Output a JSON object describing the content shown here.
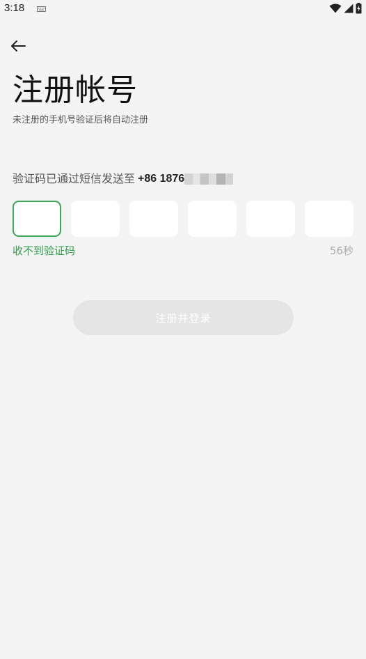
{
  "status_bar": {
    "time": "3:18"
  },
  "header": {
    "back_icon": "arrow-left-icon"
  },
  "main": {
    "title": "注册帐号",
    "subtitle": "未注册的手机号验证后将自动注册",
    "sent_prefix": "验证码已通过短信发送至",
    "phone_visible": "+86 1876",
    "code_length": 6,
    "resend_label": "收不到验证码",
    "countdown": "56秒",
    "submit_label": "注册并登录"
  },
  "colors": {
    "accent": "#3aa757",
    "link": "#2f9e4a",
    "background": "#f4f4f4",
    "disabled_button": "#e5e5e5"
  }
}
